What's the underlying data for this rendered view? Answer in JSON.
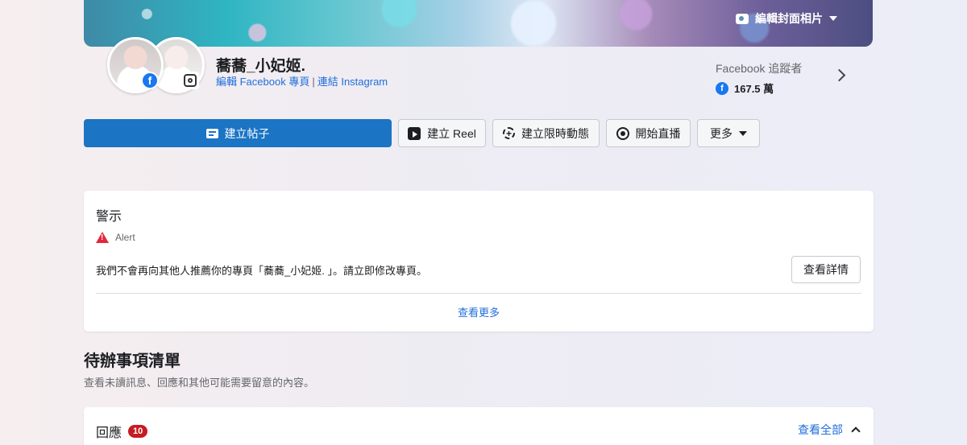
{
  "cover": {
    "edit_cover_label": "編輯封面相片"
  },
  "profile": {
    "name": "蕎蕎_小妃姬.",
    "edit_link": "編輯 Facebook 專頁",
    "link_separator": "|",
    "connect_link": "連結 Instagram",
    "followers_label": "Facebook 追蹤者",
    "followers_count": "167.5 萬"
  },
  "actions": {
    "create_post": "建立帖子",
    "create_reel": "建立 Reel",
    "create_story": "建立限時動態",
    "go_live": "開始直播",
    "more": "更多"
  },
  "alert": {
    "title": "警示",
    "type": "Alert",
    "message": "我們不會再向其他人推薦你的專頁「蕎蕎_小妃姬. 」。請立即修改專頁。",
    "details_button": "查看詳情",
    "see_more": "查看更多"
  },
  "todo": {
    "title": "待辦事項清單",
    "subtitle": "查看未讀訊息、回應和其他可能需要留意的內容。",
    "replies_label": "回應",
    "replies_count": "10",
    "see_all": "查看全部"
  },
  "colors": {
    "primary": "#1b74c4",
    "link": "#216fdb",
    "alert_red": "#e4273c",
    "badge_red": "#c61b22"
  }
}
